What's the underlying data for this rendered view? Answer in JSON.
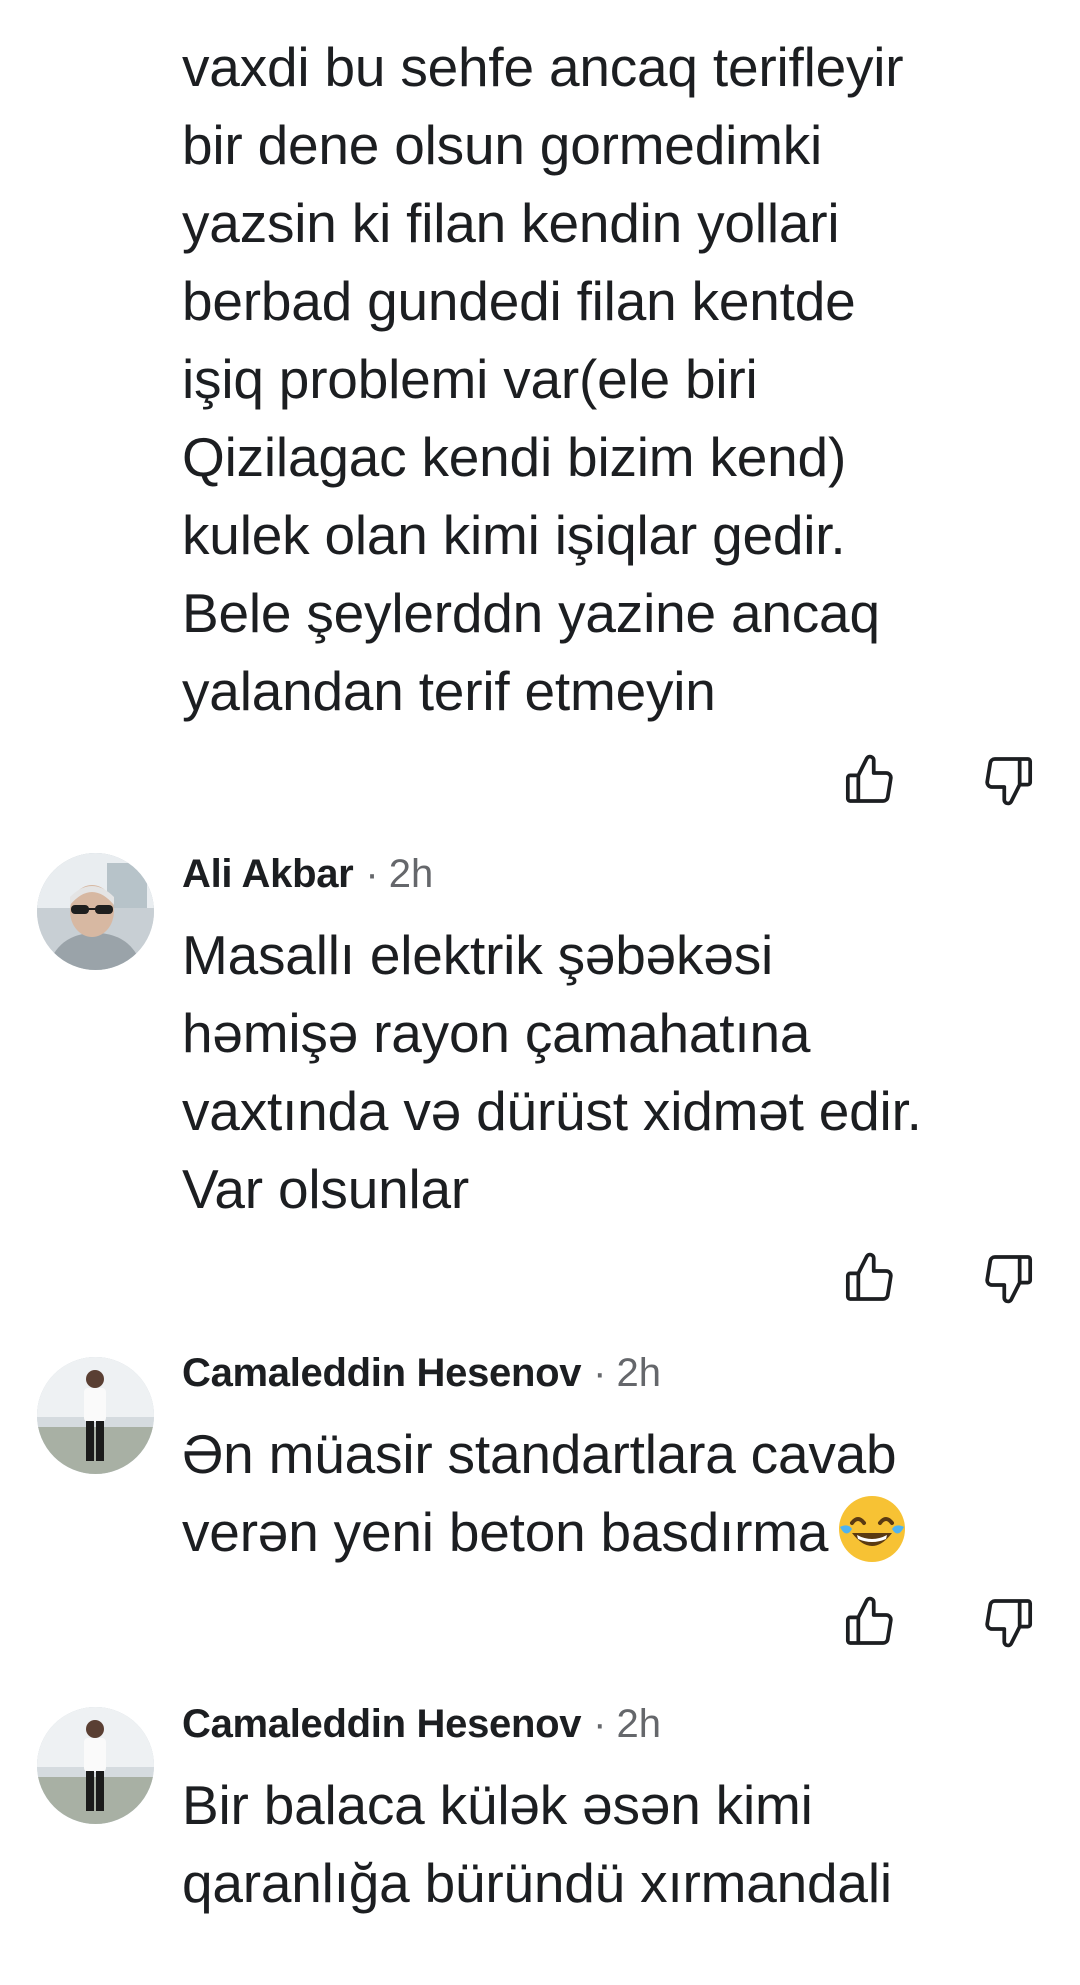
{
  "comments": [
    {
      "partial_top_line": "",
      "text": "vaxdi bu sehfe ancaq terifleyir\nbir dene olsun gormedimki\nyazsin ki filan kendin yollari\nberbad gundedi filan kentde\nişiq problemi var(ele biri\nQizilagac kendi bizim kend)\nkulek olan kimi işiqlar gedir.\nBele şeylerddn yazine ancaq\nyalandan terif etmeyin"
    },
    {
      "author": "Ali Akbar",
      "separator": "·",
      "time": "2h",
      "text": "Masallı elektrik şəbəkəsi\nhəmişə rayon çamahatına\nvaxtında və dürüst xidmət edir.\nVar olsunlar"
    },
    {
      "author": "Camaleddin Hesenov",
      "separator": "·",
      "time": "2h",
      "text": "Ən müasir standartlara cavab\nverən yeni beton basdırma",
      "emoji": "face-with-tears-of-joy"
    },
    {
      "author": "Camaleddin Hesenov",
      "separator": "·",
      "time": "2h",
      "text": "Bir balaca külək əsən kimi\nqaranlığa büründü xırmandali"
    }
  ],
  "icons": {
    "like": "thumbs-up-outline-icon",
    "dislike": "thumbs-down-outline-icon"
  },
  "colors": {
    "text": "#1c1e21",
    "meta": "#65676b",
    "icon": "#1c1e21"
  }
}
